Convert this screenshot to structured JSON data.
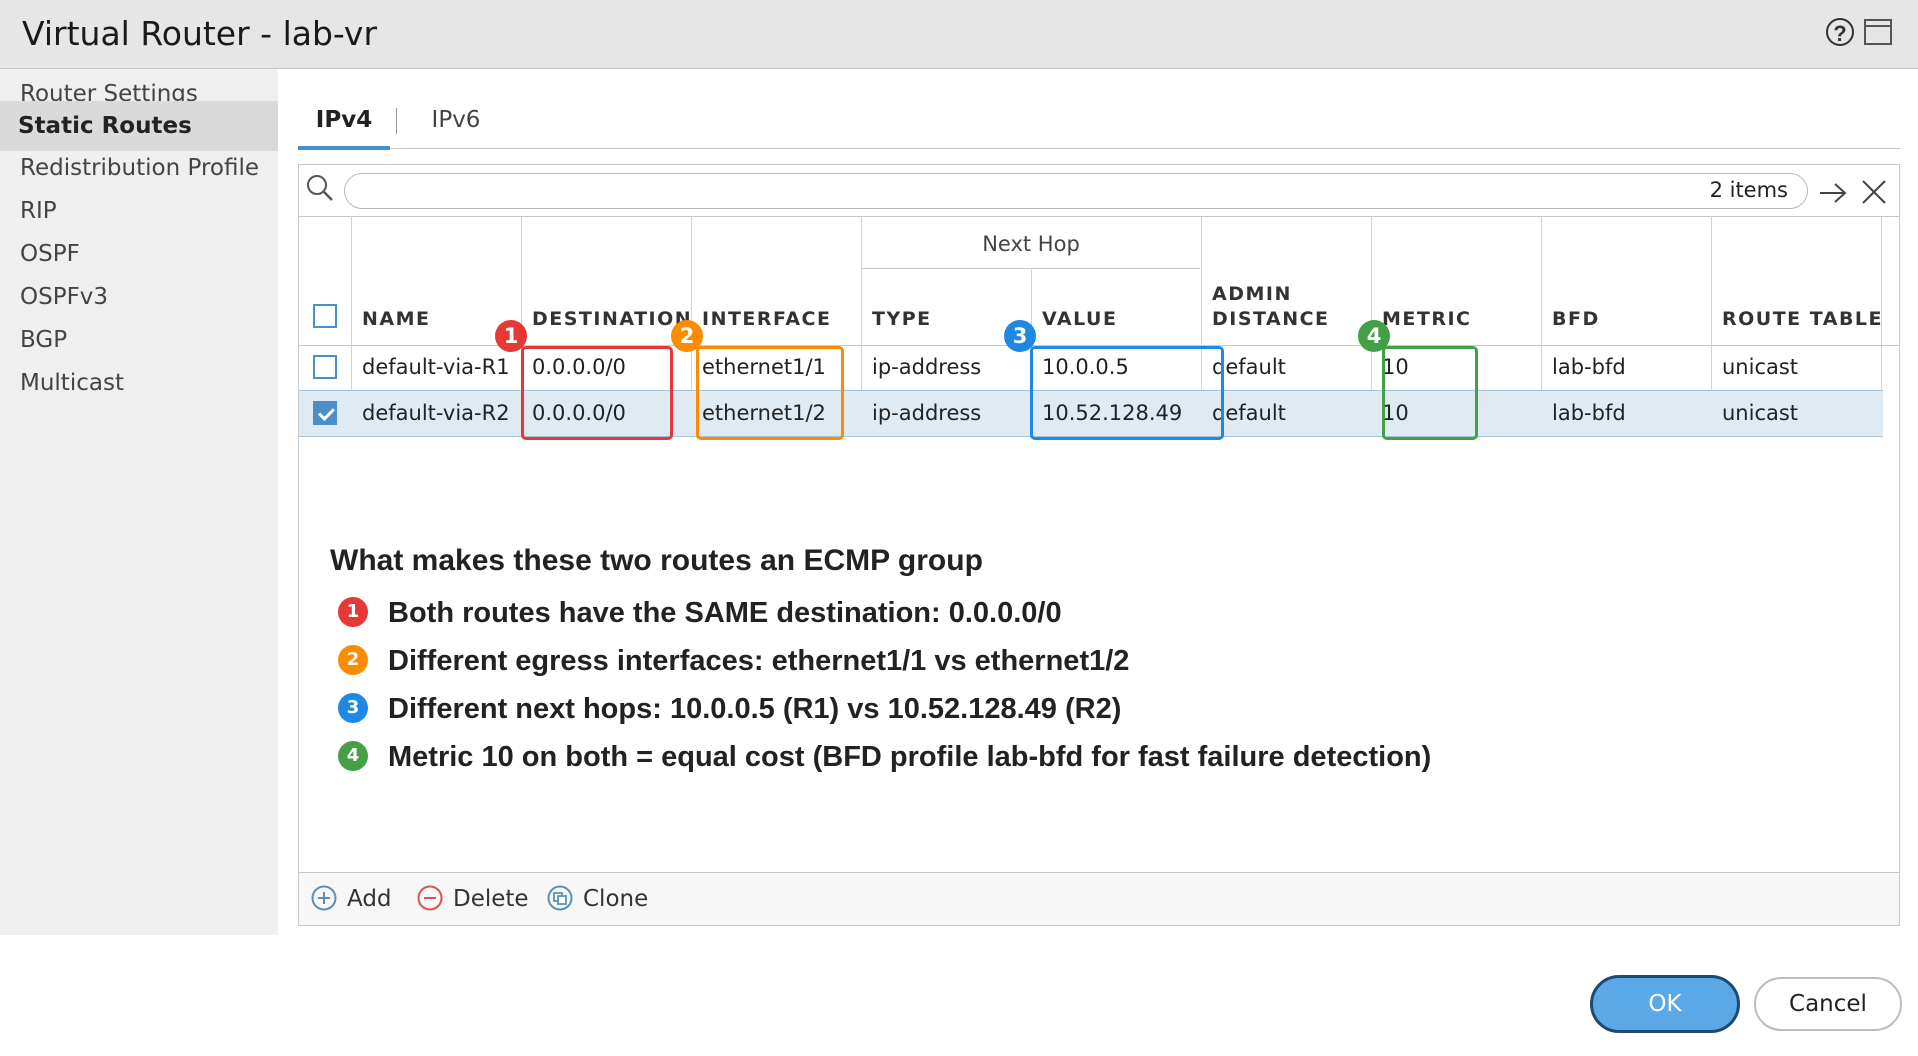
{
  "window": {
    "title": "Virtual Router - lab-vr",
    "help_icon": "?",
    "icons": [
      "help-icon",
      "window-icon",
      "search-icon",
      "arrow-right-icon",
      "close-icon",
      "add-icon",
      "delete-icon",
      "clone-icon"
    ]
  },
  "sidebar": {
    "items": [
      {
        "label": "Router Settings",
        "active": false
      },
      {
        "label": "Static Routes",
        "active": true
      },
      {
        "label": "Redistribution Profile",
        "active": false
      },
      {
        "label": "RIP",
        "active": false
      },
      {
        "label": "OSPF",
        "active": false
      },
      {
        "label": "OSPFv3",
        "active": false
      },
      {
        "label": "BGP",
        "active": false
      },
      {
        "label": "Multicast",
        "active": false
      }
    ]
  },
  "tabs": [
    {
      "label": "IPv4",
      "active": true
    },
    {
      "label": "IPv6",
      "active": false
    }
  ],
  "search": {
    "value": "",
    "items_count": "2 items"
  },
  "table": {
    "group_header": "Next Hop",
    "columns": {
      "name": "NAME",
      "destination": "DESTINATION",
      "interface": "INTERFACE",
      "type": "TYPE",
      "value": "VALUE",
      "admin_distance_1": "ADMIN",
      "admin_distance_2": "DISTANCE",
      "metric": "METRIC",
      "bfd": "BFD",
      "route_table": "ROUTE TABLE"
    },
    "rows": [
      {
        "checked": false,
        "name": "default-via-R1",
        "destination": "0.0.0.0/0",
        "interface": "ethernet1/1",
        "type": "ip-address",
        "value": "10.0.0.5",
        "admin_distance": "default",
        "metric": "10",
        "bfd": "lab-bfd",
        "route_table": "unicast"
      },
      {
        "checked": true,
        "name": "default-via-R2",
        "destination": "0.0.0.0/0",
        "interface": "ethernet1/2",
        "type": "ip-address",
        "value": "10.52.128.49",
        "admin_distance": "default",
        "metric": "10",
        "bfd": "lab-bfd",
        "route_table": "unicast"
      }
    ]
  },
  "annotations": {
    "title": "What makes these two routes an ECMP group",
    "items": [
      {
        "marker": "1",
        "text": "Both routes have the SAME destination: 0.0.0.0/0"
      },
      {
        "marker": "2",
        "text": "Different egress interfaces: ethernet1/1 vs ethernet1/2"
      },
      {
        "marker": "3",
        "text": "Different next hops: 10.0.0.5 (R1) vs 10.52.128.49 (R2)"
      },
      {
        "marker": "4",
        "text": "Metric 10 on both = equal cost (BFD profile lab-bfd for fast failure detection)"
      }
    ],
    "colors": {
      "1": "#e53935",
      "2": "#fb8c00",
      "3": "#1e88e5",
      "4": "#43a047"
    }
  },
  "footer": {
    "add": "Add",
    "delete": "Delete",
    "clone": "Clone"
  },
  "dialog_buttons": {
    "ok": "OK",
    "cancel": "Cancel"
  }
}
